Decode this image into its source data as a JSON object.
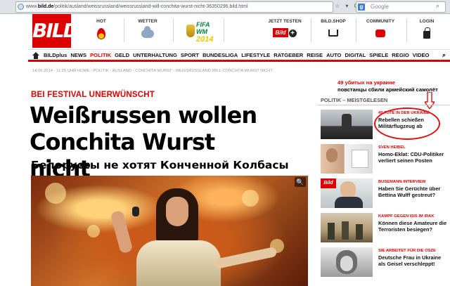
{
  "browser": {
    "url_prefix": "www.",
    "url_domain": "bild.de",
    "url_path": "/politik/ausland/weissrussland/weissrussland-will-conchita-wurst-nicht-36350296.bild.html",
    "search_placeholder": "Google",
    "search_engine_letter": "g",
    "nav_buttons": "☆ ▾ C"
  },
  "header": {
    "logo_text": "BILD",
    "items": [
      {
        "label": "HOT"
      },
      {
        "label": "WETTER"
      },
      {
        "label": "JETZT TESTEN"
      },
      {
        "label": "BILD.SHOP"
      },
      {
        "label": "COMMUNITY"
      },
      {
        "label": "LOGIN"
      }
    ],
    "fifa_line1": "FIFA WM",
    "fifa_line2": "2014",
    "bild_plus_mini": "Bild",
    "plus": "+"
  },
  "nav": {
    "items": [
      "BILDplus",
      "NEWS",
      "POLITIK",
      "GELD",
      "UNTERHALTUNG",
      "SPORT",
      "BUNDESLIGA",
      "LIFESTYLE",
      "RATGEBER",
      "REISE",
      "AUTO",
      "DIGITAL",
      "SPIELE",
      "REGIO",
      "VIDEO"
    ],
    "active": "POLITIK",
    "search_glyph": "🔍"
  },
  "breadcrumb": "14.06.2014 - 11:25 UHR   HOME › POLITIK › AUSLAND › CONCHITA WURST › WEISSRUSSLAND WILL CONCHITA WURST NICHT",
  "article": {
    "kicker": "BEI FESTIVAL UNERWÜNSCHT",
    "headline_line1": "Weißrussen wollen",
    "headline_line2": "Conchita Wurst nicht",
    "ru_caption": "Белоруссы не хотят Конченной Колбасы",
    "zoom_glyph": "🔍"
  },
  "annotation": {
    "line1": "49 убитых на украине",
    "line2": "повстанцы сбили армейский самолёт"
  },
  "sidebar": {
    "heading": "POLITIK – MEISTGELESEN",
    "items": [
      {
        "kicker": "49 TOTE IN DER UKRAINE",
        "title": "Rebellen schießen Militärflugzeug ab"
      },
      {
        "kicker": "SVEN HEIBEL",
        "title": "Homo-Eklat: CDU-Politiker verliert seinen Posten"
      },
      {
        "kicker": "BUSEMANN-INTERVIEW",
        "title": "Haben Sie Gerüchte über Bettina Wulff gestreut?"
      },
      {
        "kicker": "KAMPF GEGEN ISIS IM IRAK",
        "title": "Können diese Amateure die Terroristen besiegen?"
      },
      {
        "kicker": "SIE ARBEITET FÜR DIE OSZE",
        "title": "Deutsche Frau in Ukraine als Geisel verschleppt!"
      }
    ],
    "thumb_bild_label": "Bild"
  },
  "colors": {
    "brand_red": "#dd0000",
    "annotation_red": "#e01010"
  }
}
